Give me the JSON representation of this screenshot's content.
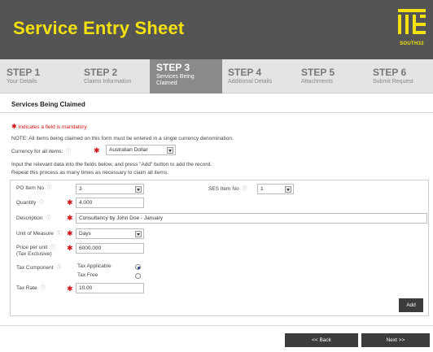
{
  "header": {
    "title": "Service Entry Sheet",
    "logo_text": "SOUTH32"
  },
  "steps": [
    {
      "num": "STEP 1",
      "label": "Your Details"
    },
    {
      "num": "STEP 2",
      "label": "Claims Information"
    },
    {
      "num": "STEP 3",
      "label": "Services Being Claimed"
    },
    {
      "num": "STEP 4",
      "label": "Additional Details"
    },
    {
      "num": "STEP 5",
      "label": "Attachments"
    },
    {
      "num": "STEP 6",
      "label": "Submit Request"
    }
  ],
  "active_step": "STEP 3",
  "section_title": "Services Being Claimed",
  "mandatory_note": "Indicates a field is mandatory",
  "currency_note": "NOTE: All items being claimed on this form must be entered in a single currency denomination.",
  "currency": {
    "label": "Currency for all items:",
    "value": "Australian Dollar"
  },
  "instructions": [
    "Input the relevant data into the fields below, and press \"Add\" button to add the record.",
    "Repeat this process as many times as necessary to claim all items."
  ],
  "form": {
    "po_item": {
      "label": "PO Item No",
      "value": "3"
    },
    "ses_item": {
      "label": "SES Item No",
      "value": "1"
    },
    "quantity": {
      "label": "Quantity",
      "value": "4.000"
    },
    "description": {
      "label": "Description",
      "value": "Consultancy by John Doe - January"
    },
    "unit_of_measure": {
      "label": "Unit of Measure",
      "value": "Days"
    },
    "price_per_unit": {
      "label": "Price per unit",
      "sublabel": "(Tax Exclusive)",
      "value": "6000.000"
    },
    "tax_component": {
      "label": "Tax Component",
      "options": [
        "Tax Applicable",
        "Tax Free"
      ],
      "selected": "Tax Applicable"
    },
    "tax_rate": {
      "label": "Tax Rate",
      "value": "10.00"
    },
    "add_label": "Add"
  },
  "nav": {
    "back_label": "<< Back",
    "next_label": "Next >>"
  },
  "help_glyph": "ⓘ",
  "colors": {
    "header_bg": "#545454",
    "accent_yellow": "#f2e10d",
    "active_step_bg": "#8a8a8a",
    "button_bg": "#3c3c3c",
    "mandatory_red": "#d01010"
  }
}
